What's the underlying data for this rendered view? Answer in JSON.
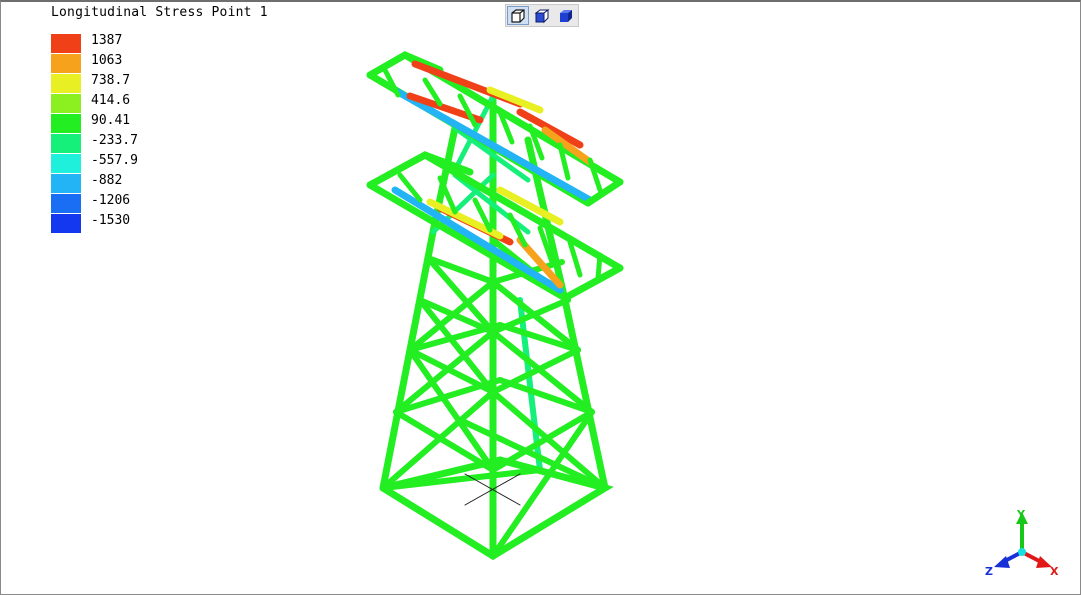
{
  "viewport": {
    "legend_title": "Longitudinal Stress Point 1",
    "legend": [
      {
        "label": "1387",
        "color": "#f04018"
      },
      {
        "label": "1063",
        "color": "#f7a21c"
      },
      {
        "label": "738.7",
        "color": "#e8ef22"
      },
      {
        "label": "414.6",
        "color": "#8cf020"
      },
      {
        "label": "90.41",
        "color": "#22ee22"
      },
      {
        "label": "-233.7",
        "color": "#14f07a"
      },
      {
        "label": "-557.9",
        "color": "#1ef0dc"
      },
      {
        "label": "-882",
        "color": "#22b4f4"
      },
      {
        "label": "-1206",
        "color": "#1a6ef4"
      },
      {
        "label": "-1530",
        "color": "#1438f0"
      }
    ]
  },
  "toolbar": {
    "buttons": [
      {
        "icon": "wireframe-cube-icon",
        "active": true
      },
      {
        "icon": "shaded-edges-cube-icon",
        "active": false
      },
      {
        "icon": "shaded-cube-icon",
        "active": false
      }
    ]
  },
  "axes": {
    "x_label": "X",
    "y_label": "Y",
    "z_label": "Z",
    "x_color": "#e01818",
    "y_color": "#18c818",
    "z_color": "#1830d8"
  }
}
